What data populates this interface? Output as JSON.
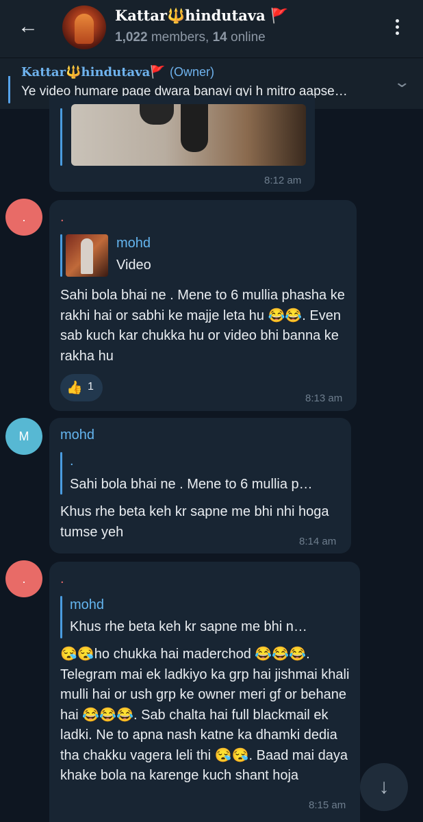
{
  "header": {
    "back_icon": "arrow-left-icon",
    "group_name_part1": "Kattar",
    "group_trident": "🔱",
    "group_name_part2": "hindutava",
    "group_flag": "🚩",
    "members_count": "1,022",
    "members_label": "members,",
    "online_count": "14",
    "online_label": "online",
    "menu_icon": "more-vertical-icon"
  },
  "pinned": {
    "sender_part1": "Kattar",
    "sender_trident": "🔱",
    "sender_part2": "hindutava",
    "sender_flag": "🚩",
    "role": "(Owner)",
    "text": "Ye video humare page dwara banayi gyi h mitro aapse…",
    "chevron_icon": "chevron-down-icon"
  },
  "messages": [
    {
      "time": "8:12 am",
      "media": "video-thumbnail"
    },
    {
      "avatar_letter": ".",
      "avatar_color": "#e86b67",
      "sender": ".",
      "reply_name": "mohd",
      "reply_text": "Video",
      "text": "Sahi bola bhai ne . Mene to 6 mullia phasha ke rakhi hai or sabhi ke majje leta hu 😂😂. Even sab kuch kar chukka hu or video bhi banna ke rakha hu",
      "reaction_emoji": "👍",
      "reaction_count": "1",
      "time": "8:13 am"
    },
    {
      "avatar_letter": "M",
      "avatar_color": "#57b8d3",
      "sender": "mohd",
      "reply_name": ".",
      "reply_text": "Sahi bola bhai ne . Mene to 6 mullia p…",
      "text": "Khus rhe beta keh kr sapne me bhi nhi hoga tumse yeh",
      "time": "8:14 am"
    },
    {
      "avatar_letter": ".",
      "avatar_color": "#e86b67",
      "sender": ".",
      "reply_name": "mohd",
      "reply_text": "Khus rhe beta keh kr sapne me bhi n…",
      "text": "😪😪ho chukka hai maderchod 😂😂😂. Telegram mai ek ladkiyo ka grp hai jishmai khali mulli hai or ush grp ke owner meri gf or behane hai 😂😂😂. Sab chalta hai full blackmail ek ladki. Ne to apna nash katne ka dhamki dedia tha chakku vagera leli thi 😪😪. Baad mai daya khake bola na karenge kuch shant hoja",
      "time": "8:15 am"
    }
  ],
  "scroll_button_icon": "arrow-down-icon",
  "colors": {
    "background": "#0e1621",
    "header": "#17212b",
    "bubble": "#182533",
    "accent": "#64b5ef"
  }
}
